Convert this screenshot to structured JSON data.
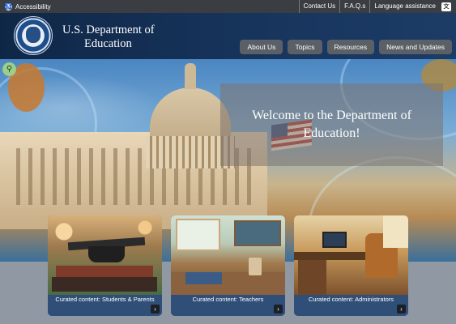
{
  "utility": {
    "accessibility_label": "Accessibility",
    "links": [
      "Contact Us",
      "F.A.Q.s",
      "Language assistance"
    ],
    "accessibility_icon": "accessibility-icon",
    "translate_icon": "translate-icon"
  },
  "header": {
    "agency_line1": "U.S. Department of",
    "agency_line2": "Education",
    "nav": [
      "About Us",
      "Topics",
      "Resources",
      "News and Updates"
    ]
  },
  "hero": {
    "welcome": "Welcome to the Department of Education!",
    "search_icon": "search-icon"
  },
  "cards": [
    {
      "label": "Curated content: Students & Parents"
    },
    {
      "label": "Curated content: Teachers"
    },
    {
      "label": "Curated content: Administrators"
    }
  ],
  "colors": {
    "header_bg": "#17345c",
    "nav_button": "#5b6066",
    "card_bar": "#2f4f78",
    "search_button": "#9bcf8a"
  }
}
